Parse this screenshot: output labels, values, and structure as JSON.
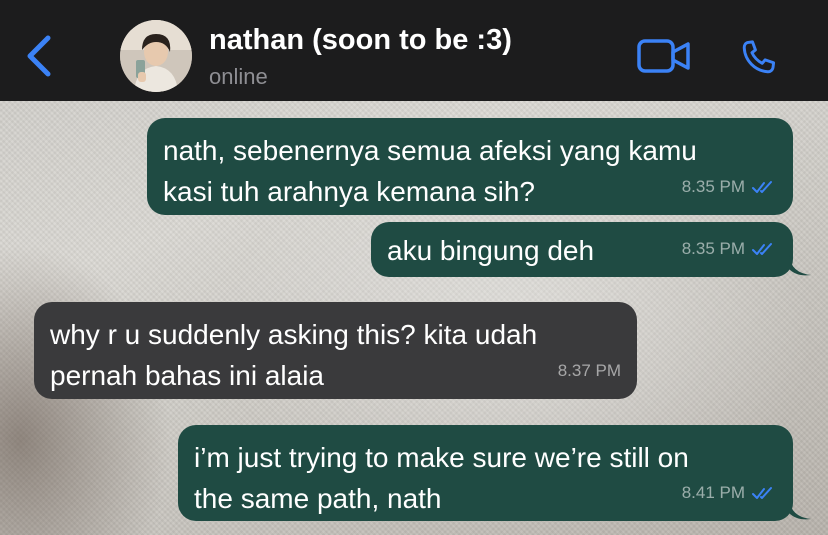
{
  "header": {
    "contact_name": "nathan (soon to be :3)",
    "status": "online",
    "icons": {
      "back": "chevron-left-icon",
      "video": "video-camera-icon",
      "call": "phone-icon"
    },
    "accent_color": "#3b82f6"
  },
  "colors": {
    "header_bg": "#1c1c1d",
    "outgoing_bubble": "#1f4b43",
    "incoming_bubble": "#3a3a3c",
    "read_ticks": "#3b82f6"
  },
  "messages": [
    {
      "direction": "outgoing",
      "lines": [
        "nath, sebenernya semua afeksi yang kamu",
        "kasi tuh arahnya kemana sih?"
      ],
      "time": "8.35 PM",
      "read": true
    },
    {
      "direction": "outgoing",
      "lines": [
        "aku bingung deh"
      ],
      "time": "8.35 PM",
      "read": true
    },
    {
      "direction": "incoming",
      "lines": [
        "why r u suddenly asking this? kita udah",
        "pernah bahas ini alaia"
      ],
      "time": "8.37 PM"
    },
    {
      "direction": "outgoing",
      "lines": [
        "i’m just trying to make sure we’re still on",
        "the same path, nath"
      ],
      "time": "8.41 PM",
      "read": true
    }
  ]
}
